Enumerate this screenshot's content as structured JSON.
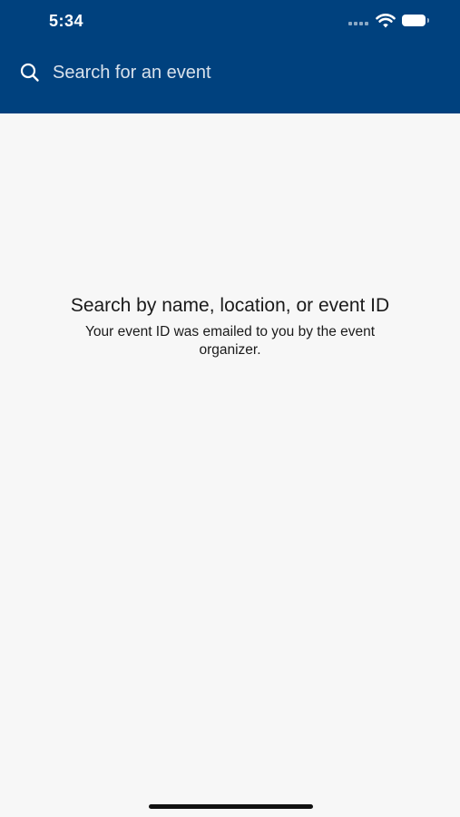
{
  "status_bar": {
    "time": "5:34"
  },
  "search": {
    "placeholder": "Search for an event",
    "value": ""
  },
  "empty_state": {
    "title": "Search by name, location, or event ID",
    "subtitle": "Your event ID was emailed to you by the event organizer."
  },
  "colors": {
    "header_background": "#00417e",
    "page_background": "#f7f7f7",
    "text": "#1a1a1a"
  },
  "icons": [
    "signal-icon",
    "wifi-icon",
    "battery-icon",
    "search-icon"
  ]
}
